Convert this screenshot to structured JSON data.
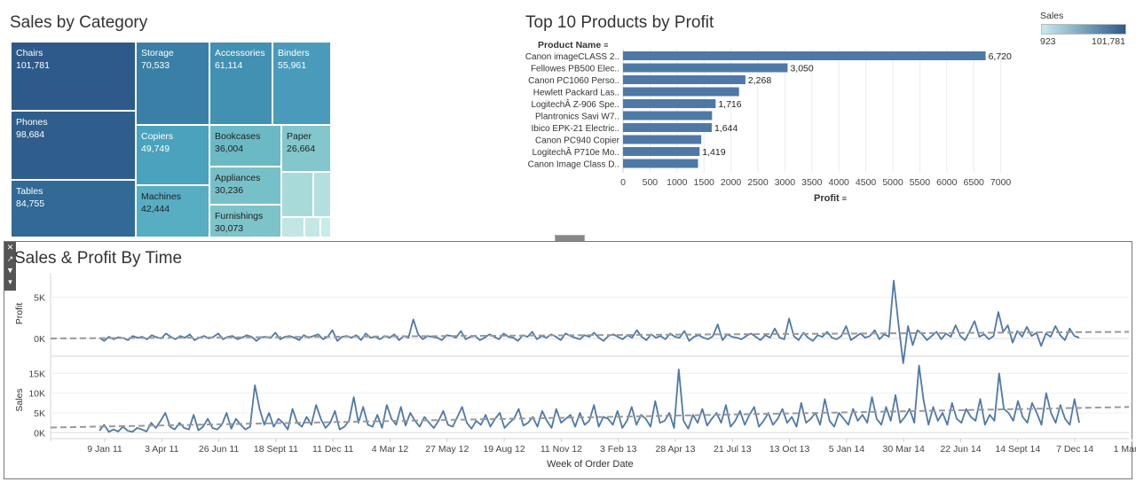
{
  "treemap": {
    "title": "Sales by Category",
    "legend": {
      "title": "Sales",
      "min_label": "923",
      "max_label": "101,781"
    },
    "cells": [
      {
        "name": "Chairs",
        "value": "101,781",
        "color": "#2d5a8a",
        "text": "#ffffff"
      },
      {
        "name": "Phones",
        "value": "98,684",
        "color": "#2f5e8d",
        "text": "#ffffff"
      },
      {
        "name": "Tables",
        "value": "84,755",
        "color": "#316a97",
        "text": "#ffffff"
      },
      {
        "name": "Storage",
        "value": "70,533",
        "color": "#3a7fa6",
        "text": "#ffffff"
      },
      {
        "name": "Accessories",
        "value": "61,114",
        "color": "#4290b2",
        "text": "#ffffff"
      },
      {
        "name": "Binders",
        "value": "55,961",
        "color": "#4a9bbb",
        "text": "#ffffff"
      },
      {
        "name": "Copiers",
        "value": "49,749",
        "color": "#4aa2bd",
        "text": "#ffffff"
      },
      {
        "name": "Machines",
        "value": "42,444",
        "color": "#57adc2",
        "text": "#222222"
      },
      {
        "name": "Bookcases",
        "value": "36,004",
        "color": "#6ab9c5",
        "text": "#222222"
      },
      {
        "name": "Appliances",
        "value": "30,236",
        "color": "#78c0c9",
        "text": "#222222"
      },
      {
        "name": "Furnishings",
        "value": "30,073",
        "color": "#7cc3ca",
        "text": "#222222"
      },
      {
        "name": "Paper",
        "value": "26,664",
        "color": "#83c6cb",
        "text": "#222222"
      }
    ]
  },
  "bar_chart": {
    "title": "Top 10 Products by Profit",
    "header": "Product Name",
    "xlabel": "Profit",
    "color": "#4e79a7"
  },
  "line_chart": {
    "title": "Sales & Profit By Time",
    "xlabel": "Week of Order Date",
    "profit_label": "Profit",
    "sales_label": "Sales",
    "line_color": "#4e79a7",
    "trend_color": "#999999"
  },
  "chart_data": [
    {
      "type": "treemap",
      "title": "Sales by Category",
      "labels": [
        "Chairs",
        "Phones",
        "Tables",
        "Storage",
        "Accessories",
        "Binders",
        "Copiers",
        "Machines",
        "Bookcases",
        "Appliances",
        "Furnishings",
        "Paper"
      ],
      "values": [
        101781,
        98684,
        84755,
        70533,
        61114,
        55961,
        49749,
        42444,
        36004,
        30236,
        30073,
        26664
      ]
    },
    {
      "type": "bar",
      "orientation": "horizontal",
      "title": "Top 10 Products by Profit",
      "categories": [
        "Canon imageCLASS 2..",
        "Fellowes PB500 Elec..",
        "Canon PC1060 Perso..",
        "Hewlett Packard Las..",
        "LogitechÂ Z-906 Spe..",
        "Plantronics Savi W7..",
        "Ibico EPK-21 Electric..",
        "Canon PC940 Copier",
        "LogitechÂ P710e Mo..",
        "Canon Image Class D.."
      ],
      "values": [
        6720,
        3050,
        2268,
        2150,
        1716,
        1650,
        1644,
        1450,
        1419,
        1390
      ],
      "data_labels": [
        "6,720",
        "3,050",
        "2,268",
        "",
        "1,716",
        "",
        "1,644",
        "",
        "1,419",
        ""
      ],
      "xlabel": "Profit",
      "xlim": [
        0,
        7500
      ],
      "xticks": [
        "0",
        "500",
        "1000",
        "1500",
        "2000",
        "2500",
        "3000",
        "3500",
        "4000",
        "4500",
        "5000",
        "5500",
        "6000",
        "6500",
        "7000"
      ]
    },
    {
      "type": "line",
      "title": "Sales & Profit By Time",
      "xlabel": "Week of Order Date",
      "x_ticks": [
        "9 Jan 11",
        "3 Apr 11",
        "26 Jun 11",
        "18 Sept 11",
        "11 Dec 11",
        "4 Mar 12",
        "27 May 12",
        "19 Aug 12",
        "11 Nov 12",
        "3 Feb 13",
        "28 Apr 13",
        "21 Jul 13",
        "13 Oct 13",
        "5 Jan 14",
        "30 Mar 14",
        "22 Jun 14",
        "14 Sept 14",
        "7 Dec 14",
        "1 Mar 15"
      ],
      "series": [
        {
          "name": "Profit",
          "ylim": [
            -1500,
            7500
          ],
          "yticks": [
            "0K",
            "5K"
          ],
          "values": [
            100,
            -300,
            200,
            -100,
            150,
            50,
            -200,
            300,
            100,
            200,
            -100,
            400,
            150,
            0,
            600,
            200,
            -100,
            300,
            100,
            500,
            -200,
            100,
            300,
            0,
            200,
            600,
            -100,
            200,
            300,
            -100,
            100,
            400,
            200,
            -300,
            150,
            200,
            50,
            700,
            -100,
            200,
            300,
            100,
            -200,
            400,
            100,
            300,
            500,
            -100,
            200,
            1000,
            -300,
            200,
            300,
            100,
            400,
            -200,
            600,
            100,
            200,
            -100,
            300,
            100,
            500,
            -200,
            300,
            100,
            2300,
            500,
            -100,
            300,
            200,
            100,
            -200,
            400,
            300,
            100,
            900,
            -100,
            200,
            300,
            -200,
            100,
            500,
            200,
            -100,
            600,
            200,
            100,
            -300,
            400,
            200,
            800,
            -100,
            300,
            100,
            500,
            200,
            -200,
            600,
            300,
            100,
            -100,
            400,
            200,
            700,
            100,
            -300,
            300,
            500,
            200,
            -100,
            400,
            100,
            1000,
            200,
            -200,
            500,
            100,
            300,
            -100,
            600,
            200,
            100,
            900,
            -300,
            200,
            400,
            100,
            -100,
            300,
            1700,
            -200,
            500,
            200,
            100,
            -100,
            300,
            600,
            200,
            -200,
            400,
            100,
            1200,
            100,
            -100,
            2400,
            300,
            -200,
            700,
            100,
            -300,
            400,
            200,
            800,
            100,
            -100,
            300,
            1500,
            -200,
            200,
            600,
            100,
            300,
            1000,
            -100,
            500,
            200,
            7000,
            1800,
            -3000,
            1500,
            -800,
            1000,
            500,
            -200,
            300,
            800,
            -100,
            600,
            200,
            1600,
            300,
            -200,
            900,
            2100,
            200,
            500,
            -100,
            300,
            3200,
            800,
            1600,
            -500,
            900,
            200,
            1400,
            300,
            700,
            -900,
            600,
            200,
            1500,
            400,
            -200,
            1200,
            300,
            100
          ]
        },
        {
          "name": "Sales",
          "ylim": [
            -1500,
            18000
          ],
          "yticks": [
            "0K",
            "5K",
            "10K",
            "15K"
          ],
          "values": [
            500,
            2000,
            200,
            800,
            300,
            1500,
            500,
            200,
            1200,
            800,
            300,
            2500,
            1200,
            3000,
            5000,
            1500,
            800,
            2500,
            1200,
            800,
            4500,
            600,
            1500,
            3500,
            1200,
            800,
            2000,
            5000,
            1000,
            3500,
            2000,
            800,
            1500,
            12000,
            6000,
            2000,
            5000,
            1500,
            3500,
            2500,
            800,
            6000,
            2500,
            1500,
            4000,
            2000,
            7000,
            3500,
            1200,
            2500,
            5500,
            800,
            1500,
            3000,
            9000,
            2500,
            6500,
            2000,
            1500,
            4500,
            1200,
            7000,
            3500,
            2000,
            6500,
            1800,
            5000,
            3000,
            1500,
            4000,
            2500,
            1200,
            3000,
            5500,
            2000,
            1500,
            4000,
            6500,
            2500,
            1000,
            3000,
            2000,
            4500,
            1500,
            3500,
            5000,
            1200,
            2500,
            3500,
            6000,
            1800,
            2500,
            4000,
            1500,
            5500,
            3000,
            1200,
            6000,
            2500,
            3500,
            4500,
            1500,
            5000,
            2000,
            3000,
            7000,
            1500,
            4000,
            3500,
            2000,
            5500,
            1200,
            3000,
            6500,
            2000,
            4500,
            3500,
            1500,
            8000,
            2500,
            3000,
            5000,
            1200,
            16000,
            3000,
            1000,
            4500,
            2500,
            6000,
            1800,
            3500,
            5000,
            2500,
            7000,
            1500,
            3000,
            5500,
            2000,
            4500,
            6500,
            1500,
            3000,
            5000,
            2000,
            3500,
            6000,
            2500,
            4000,
            1500,
            7500,
            2500,
            3500,
            5000,
            2000,
            8500,
            3000,
            1500,
            5000,
            3500,
            2000,
            6000,
            3000,
            4500,
            2500,
            9000,
            3500,
            2000,
            6500,
            3000,
            9500,
            2500,
            4000,
            6000,
            2500,
            17000,
            8000,
            2000,
            6500,
            3000,
            5000,
            2000,
            7500,
            3500,
            2500,
            6000,
            4000,
            3000,
            8500,
            2000,
            4500,
            3000,
            15000,
            6000,
            5000,
            3000,
            8000,
            4000,
            2500,
            7500,
            5000,
            2000,
            10000,
            5000,
            2500,
            7000,
            3500,
            2000,
            8500,
            2500
          ]
        }
      ]
    }
  ]
}
